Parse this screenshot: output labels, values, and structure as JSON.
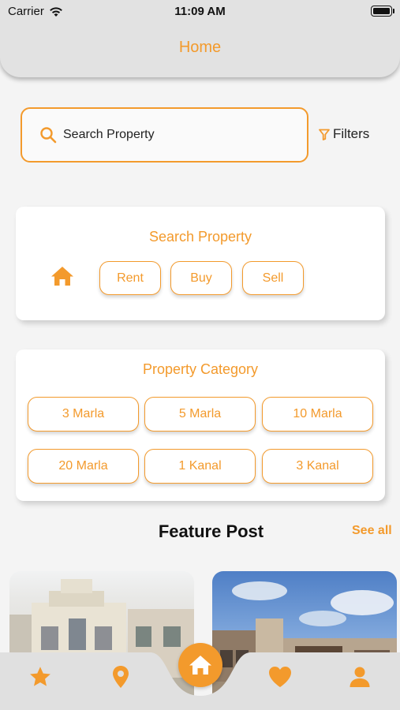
{
  "status_bar": {
    "carrier": "Carrier",
    "time": "11:09 AM"
  },
  "header": {
    "title": "Home"
  },
  "search": {
    "placeholder": "Search Property",
    "filters_label": "Filters"
  },
  "search_card": {
    "title": "Search Property",
    "options": [
      "Rent",
      "Buy",
      "Sell"
    ]
  },
  "category_card": {
    "title": "Property Category",
    "categories": [
      "3 Marla",
      "5 Marla",
      "10 Marla",
      "20 Marla",
      "1 Kanal",
      "3 Kanal"
    ]
  },
  "feature": {
    "title": "Feature Post",
    "see_all": "See all"
  },
  "bottom_nav": {
    "items": [
      "star-icon",
      "location-pin-icon",
      "home-icon",
      "heart-icon",
      "user-icon"
    ]
  },
  "colors": {
    "accent": "#f39a2c",
    "background": "#f4f4f4",
    "header": "#e2e2e2"
  }
}
